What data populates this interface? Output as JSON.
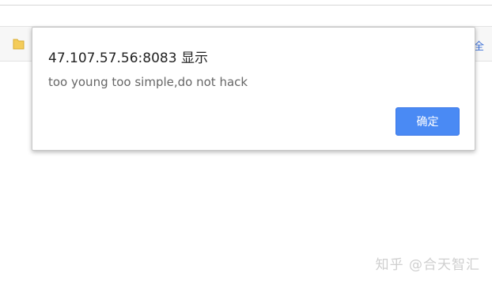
{
  "bookmarks": {
    "folder_icon": "folder-icon",
    "right_text": "全"
  },
  "dialog": {
    "title": "47.107.57.56:8083 显示",
    "message": "too young too simple,do not hack",
    "ok_label": "确定"
  },
  "watermark": {
    "text": "知乎 @合天智汇"
  },
  "colors": {
    "button_bg": "#4a8af4",
    "folder": "#f4cc5a",
    "watermark": "#cfcfcf"
  }
}
